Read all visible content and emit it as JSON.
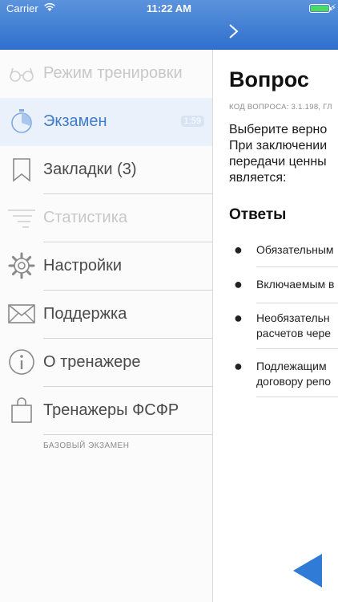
{
  "status": {
    "carrier": "Carrier",
    "time": "11:22 AM"
  },
  "sidebar": {
    "items": [
      {
        "label": "Режим тренировки",
        "icon": "glasses-icon"
      },
      {
        "label": "Экзамен",
        "icon": "stopwatch-icon",
        "badge": "1:59"
      },
      {
        "label": "Закладки (3)",
        "icon": "bookmark-icon"
      },
      {
        "label": "Статистика",
        "icon": "list-icon"
      },
      {
        "label": "Настройки",
        "icon": "gear-icon"
      },
      {
        "label": "Поддержка",
        "icon": "mail-icon"
      },
      {
        "label": "О тренажере",
        "icon": "info-icon"
      },
      {
        "label": "Тренажеры ФСФР",
        "icon": "bag-icon"
      }
    ],
    "footer": "БАЗОВЫЙ ЭКЗАМЕН"
  },
  "question": {
    "title": "Вопрос",
    "code": "КОД ВОПРОСА: 3.1.198, ГЛ",
    "text": "Выберите верно\nПри заключении\nпередачи ценны\nявляется:"
  },
  "answers": {
    "title": "Ответы",
    "items": [
      "Обязательным",
      "Включаемым в",
      "Необязательн\nрасчетов чере",
      "Подлежащим\nдоговору репо"
    ]
  },
  "colors": {
    "accent": "#3f7cc9",
    "topbar": "#2f6fcd"
  }
}
